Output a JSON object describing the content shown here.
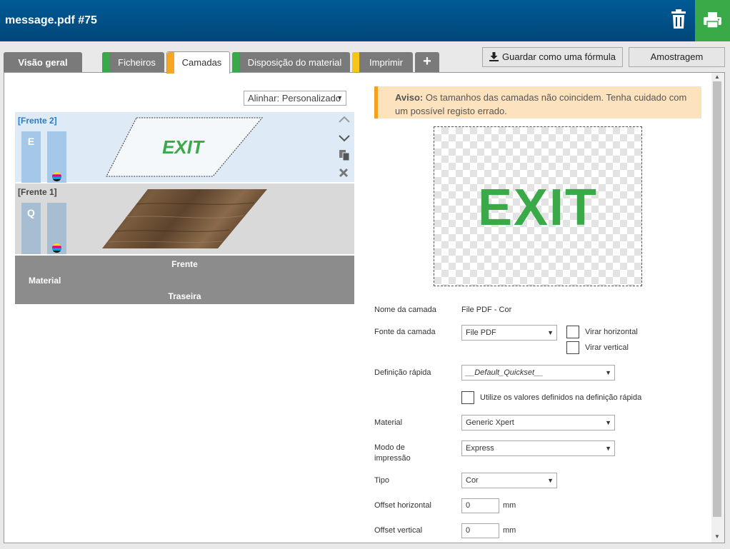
{
  "header": {
    "title": "message.pdf #75"
  },
  "tabs": [
    {
      "label": "Visão geral"
    },
    {
      "label": "Ficheiros",
      "stripe": "#3aaa49"
    },
    {
      "label": "Camadas",
      "stripe": "#f5a623"
    },
    {
      "label": "Disposição do material",
      "stripe": "#3aaa49"
    },
    {
      "label": "Imprimir",
      "stripe": "#f5c518"
    },
    {
      "label": "+"
    }
  ],
  "toolbar": {
    "save_formula": "Guardar como uma fórmula",
    "sample": "Amostragem"
  },
  "align": {
    "value": "Alinhar: Personalizado"
  },
  "layers": [
    {
      "title": "[Frente 2]",
      "letter": "E",
      "artwork_text": "EXIT"
    },
    {
      "title": "[Frente 1]",
      "letter": "Q"
    }
  ],
  "material_bar": {
    "front": "Frente",
    "material": "Material",
    "back": "Traseira"
  },
  "warning": {
    "label": "Aviso:",
    "text": "Os tamanhos das camadas não coincidem. Tenha cuidado com um possível registo errado."
  },
  "preview": {
    "text": "EXIT"
  },
  "form": {
    "layer_name_label": "Nome da camada",
    "layer_name_value": "File PDF - Cor",
    "layer_source_label": "Fonte da camada",
    "layer_source_value": "File PDF",
    "flip_h": "Virar horizontal",
    "flip_v": "Virar vertical",
    "quickset_label": "Definição rápida",
    "quickset_value": "__Default_Quickset__",
    "use_quickset": "Utilize os valores definidos na definição rápida",
    "material_label": "Material",
    "material_value": "Generic Xpert",
    "print_mode_label_1": "Modo de",
    "print_mode_label_2": "impressão",
    "print_mode_value": "Express",
    "type_label": "Tipo",
    "type_value": "Cor",
    "offset_h_label": "Offset horizontal",
    "offset_h_value": "0",
    "offset_v_label": "Offset vertical",
    "offset_v_value": "0",
    "unit": "mm"
  },
  "colors": {
    "brand": "#01477a",
    "accent_green": "#3aaa49",
    "warning_bg": "#fde2be",
    "warning_border": "#f5a11f"
  }
}
